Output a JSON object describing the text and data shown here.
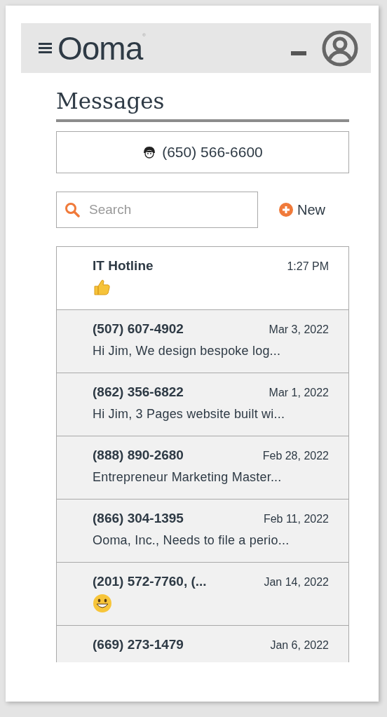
{
  "header": {
    "logo": "Ooma",
    "registered_mark": "®"
  },
  "title": "Messages",
  "line_button": {
    "label": "(650) 566-6600"
  },
  "search": {
    "placeholder": "Search"
  },
  "new_button": {
    "label": "New"
  },
  "conversations": [
    {
      "name": "IT Hotline",
      "time": "1:27 PM",
      "kind": "thumbsup",
      "selected": true
    },
    {
      "name": "(507) 607-4902",
      "time": "Mar 3, 2022",
      "preview": "Hi Jim, We design bespoke log...",
      "selected": false
    },
    {
      "name": "(862) 356-6822",
      "time": "Mar 1, 2022",
      "preview": "Hi Jim, 3 Pages website built wi...",
      "selected": false
    },
    {
      "name": "(888) 890-2680",
      "time": "Feb 28, 2022",
      "preview": "Entrepreneur Marketing Master...",
      "selected": false
    },
    {
      "name": "(866) 304-1395",
      "time": "Feb 11, 2022",
      "preview": "Ooma, Inc., Needs to file a perio...",
      "selected": false
    },
    {
      "name": "(201) 572-7760, (...",
      "time": "Jan 14, 2022",
      "kind": "grin",
      "selected": false
    },
    {
      "name": "(669) 273-1479",
      "time": "Jan 6, 2022",
      "selected": false
    }
  ]
}
